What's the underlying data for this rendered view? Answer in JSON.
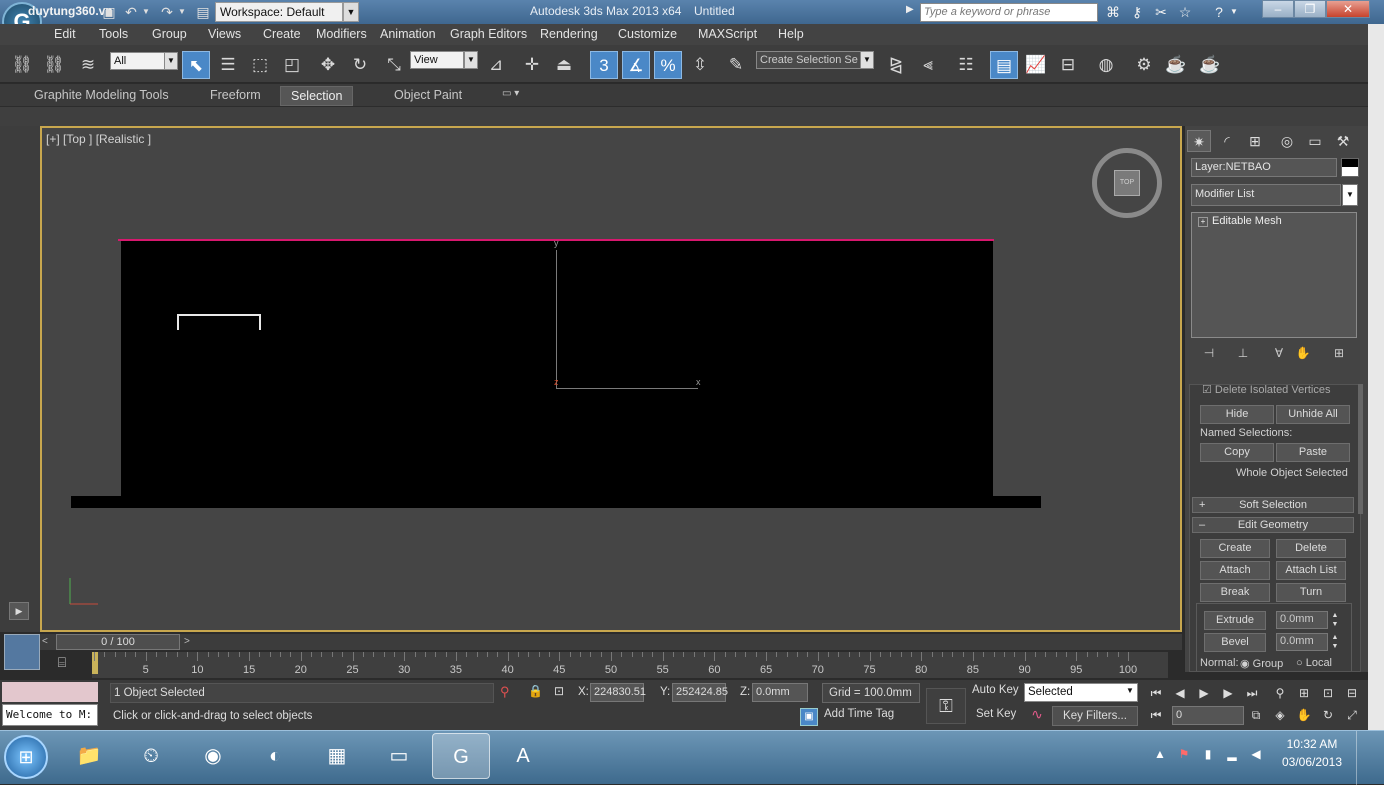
{
  "titlebar": {
    "app_title": "Autodesk 3ds Max  2013 x64",
    "doc_title": "Untitled",
    "workspace": "Workspace: Default",
    "search_placeholder": "Type a keyword or phrase",
    "watermark": "duytung360.vn"
  },
  "menu": [
    "Edit",
    "Tools",
    "Group",
    "Views",
    "Create",
    "Modifiers",
    "Animation",
    "Graph Editors",
    "Rendering",
    "Customize",
    "MAXScript",
    "Help"
  ],
  "toolbar": {
    "filter": "All",
    "ref_coord": "View",
    "selection_set": "Create Selection Se",
    "snap_label": "3",
    "percent_label": "%"
  },
  "ribbon": {
    "tabs": [
      "Graphite Modeling Tools",
      "Freeform",
      "Selection",
      "Object Paint"
    ],
    "active": "Selection"
  },
  "viewport": {
    "label": "[+] [Top ] [Realistic ]",
    "viewcube_face": "TOP",
    "axis_y": "y",
    "axis_x": "x",
    "axis_z": "z"
  },
  "command_panel": {
    "layer": "Layer:NETBAO",
    "modifier_list": "Modifier List",
    "stack_item": "Editable Mesh",
    "delete_isolated": "Delete Isolated Vertices",
    "hide": "Hide",
    "unhide_all": "Unhide All",
    "named_selections": "Named Selections:",
    "copy": "Copy",
    "paste": "Paste",
    "whole_object": "Whole Object Selected",
    "soft_selection": "Soft Selection",
    "edit_geometry": "Edit Geometry",
    "create": "Create",
    "delete": "Delete",
    "attach": "Attach",
    "attach_list": "Attach List",
    "break": "Break",
    "turn": "Turn",
    "extrude": "Extrude",
    "extrude_val": "0.0mm",
    "bevel": "Bevel",
    "bevel_val": "0.0mm",
    "normal": "Normal:",
    "group": "Group",
    "local": "Local"
  },
  "timeline": {
    "slider": "0 / 100",
    "ticks": [
      "5",
      "10",
      "15",
      "20",
      "25",
      "30",
      "35",
      "40",
      "45",
      "50",
      "55",
      "60",
      "65",
      "70",
      "75",
      "80",
      "85",
      "90",
      "95",
      "100"
    ]
  },
  "status": {
    "maxscript": "Welcome to M:",
    "selected": "1 Object Selected",
    "prompt": "Click or click-and-drag to select objects",
    "x_label": "X:",
    "x_value": "224830.51",
    "y_label": "Y:",
    "y_value": "252424.85",
    "z_label": "Z:",
    "z_value": "0.0mm",
    "grid": "Grid = 100.0mm",
    "add_time_tag": "Add Time Tag",
    "auto_key": "Auto Key",
    "set_key": "Set Key",
    "key_mode": "Selected",
    "key_filters": "Key Filters...",
    "frame": "0"
  },
  "taskbar": {
    "time": "10:32 AM",
    "date": "03/06/2013"
  }
}
